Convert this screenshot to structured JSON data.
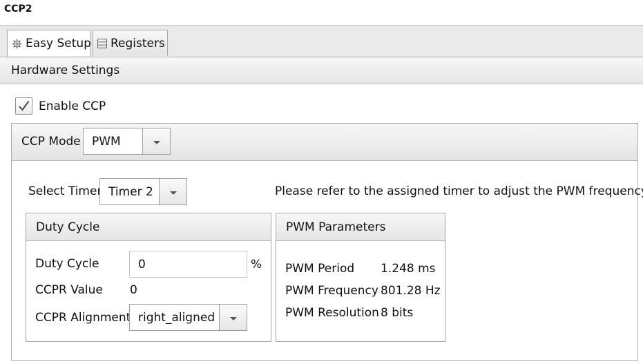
{
  "window": {
    "title": "CCP2"
  },
  "tabs": [
    {
      "label": "Easy Setup",
      "icon": "gear-icon",
      "active": true
    },
    {
      "label": "Registers",
      "icon": "list-icon",
      "active": false
    }
  ],
  "hardware": {
    "header": "Hardware Settings",
    "enable_ccp": {
      "label": "Enable CCP",
      "checked": true
    },
    "ccp_mode": {
      "label": "CCP Mode",
      "value": "PWM"
    },
    "select_timer": {
      "label": "Select Timer",
      "value": "Timer 2"
    },
    "note": "Please refer to the assigned timer to adjust the PWM frequency."
  },
  "duty_cycle": {
    "header": "Duty Cycle",
    "duty_label": "Duty Cycle",
    "duty_value": "0",
    "duty_unit": "%",
    "ccpr_label": "CCPR Value",
    "ccpr_value": "0",
    "alignment_label": "CCPR Alignment",
    "alignment_value": "right_aligned"
  },
  "pwm_params": {
    "header": "PWM Parameters",
    "period_label": "PWM Period",
    "period_value": "1.248 ms",
    "frequency_label": "PWM Frequency",
    "frequency_value": "801.28 Hz",
    "resolution_label": "PWM Resolution",
    "resolution_value": "8 bits"
  }
}
